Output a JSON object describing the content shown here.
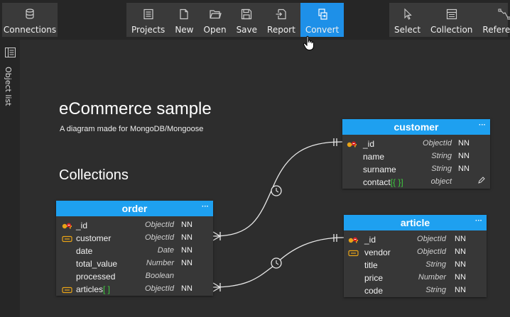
{
  "toolbar": {
    "connections": "Connections",
    "projects": "Projects",
    "new": "New",
    "open": "Open",
    "save": "Save",
    "report": "Report",
    "convert": "Convert",
    "select": "Select",
    "collection": "Collection",
    "reference": "Reference"
  },
  "sidebar": {
    "object_list": "Object list"
  },
  "diagram": {
    "title": "eCommerce sample",
    "subtitle": "A diagram made for MongoDB/Mongoose",
    "section": "Collections"
  },
  "colors": {
    "accent": "#1ea0f0",
    "active_button": "#1e90e8",
    "array_bracket": "#3ec83e"
  },
  "collections": {
    "order": {
      "name": "order",
      "menu": "···",
      "fields": [
        {
          "icon": "primary-key-icon",
          "name": "_id",
          "bracket": "",
          "type": "ObjectId",
          "nn": "NN"
        },
        {
          "icon": "foreign-key-icon",
          "name": "customer",
          "bracket": "",
          "type": "ObjectId",
          "nn": "NN"
        },
        {
          "icon": "",
          "name": "date",
          "bracket": "",
          "type": "Date",
          "nn": "NN"
        },
        {
          "icon": "",
          "name": "total_value",
          "bracket": "",
          "type": "Number",
          "nn": "NN"
        },
        {
          "icon": "",
          "name": "processed",
          "bracket": "",
          "type": "Boolean",
          "nn": ""
        },
        {
          "icon": "foreign-key-icon",
          "name": "articles",
          "bracket": "[ ]",
          "type": "ObjectId",
          "nn": "NN"
        }
      ]
    },
    "customer": {
      "name": "customer",
      "menu": "···",
      "fields": [
        {
          "icon": "primary-key-icon",
          "name": "_id",
          "bracket": "",
          "type": "ObjectId",
          "nn": "NN"
        },
        {
          "icon": "",
          "name": "name",
          "bracket": "",
          "type": "String",
          "nn": "NN"
        },
        {
          "icon": "",
          "name": "surname",
          "bracket": "",
          "type": "String",
          "nn": "NN"
        },
        {
          "icon": "",
          "name": "contact",
          "bracket": "[{ }]",
          "type": "object",
          "nn": ""
        }
      ]
    },
    "article": {
      "name": "article",
      "menu": "···",
      "fields": [
        {
          "icon": "primary-key-icon",
          "name": "_id",
          "bracket": "",
          "type": "ObjectId",
          "nn": "NN"
        },
        {
          "icon": "foreign-key-icon",
          "name": "vendor",
          "bracket": "",
          "type": "ObjectId",
          "nn": "NN"
        },
        {
          "icon": "",
          "name": "title",
          "bracket": "",
          "type": "String",
          "nn": "NN"
        },
        {
          "icon": "",
          "name": "price",
          "bracket": "",
          "type": "Number",
          "nn": "NN"
        },
        {
          "icon": "",
          "name": "code",
          "bracket": "",
          "type": "String",
          "nn": "NN"
        }
      ]
    }
  }
}
